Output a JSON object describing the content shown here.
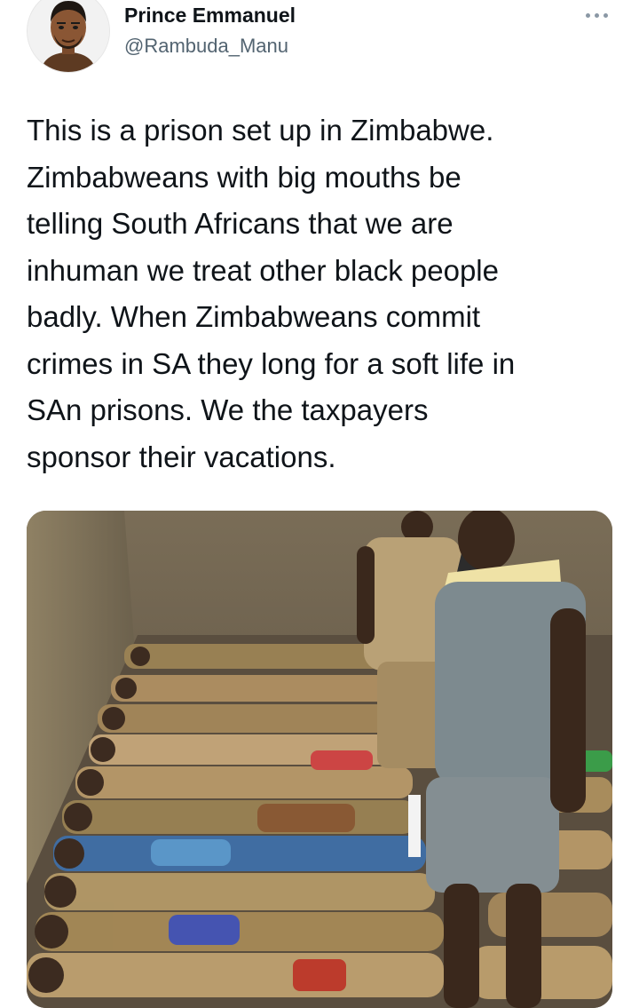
{
  "tweet": {
    "author": {
      "display_name": "Prince Emmanuel",
      "handle": "@Rambuda_Manu",
      "avatar_icon": "cartoon-avatar-icon"
    },
    "more_icon": "more-options-icon",
    "text": "This is a prison set up in Zimbabwe.\nZimbabweans with big mouths be\ntelling South Africans that we are\ninhuman we treat other black people\nbadly. When Zimbabweans commit\ncrimes in SA they long for a soft life in\nSAn prisons. We the taxpayers\nsponsor their vacations.",
    "media": {
      "type": "photo",
      "icon": "photo-image"
    }
  },
  "colors": {
    "text_primary": "#0f1419",
    "text_secondary": "#536471",
    "background": "#ffffff"
  }
}
